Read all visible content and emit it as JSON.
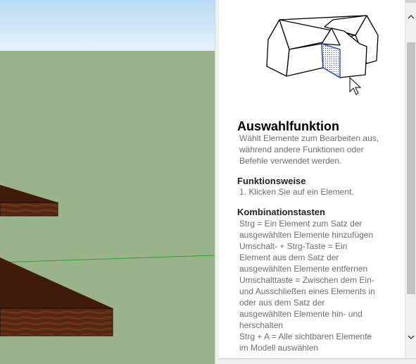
{
  "help_panel": {
    "title": "Auswahlfunktion",
    "description": "Wählt Elemente zum Bearbeiten aus, während andere Funktionen oder Befehle verwendet werden.",
    "sections": [
      {
        "heading": "Funktionsweise",
        "lines": [
          "1.  Klicken Sie auf ein Element."
        ]
      },
      {
        "heading": "Kombinationstasten",
        "lines": [
          "Strg = Ein Element zum Satz der",
          "ausgewählten Elemente hinzufügen",
          "Umschalt- + Strg-Taste = Ein",
          "Element aus dem Satz der",
          "ausgewählten Elemente entfernen",
          "Umschalttaste = Zwischen dem Ein-",
          "und Ausschließen eines Elements in",
          "oder aus dem Satz der",
          "ausgewählten Elemente hin- und",
          "herschalten",
          "Strg + A = Alle sichtbaren Elemente",
          "im Modell auswählen"
        ]
      }
    ],
    "illustration_icon": "house-select-illustration",
    "cursor_icon": "arrow-cursor-icon"
  },
  "scrollbar": {
    "up_icon": "chevron-up-icon",
    "down_icon": "chevron-down-icon"
  },
  "viewport": {
    "sky_color": "#cfe6f5",
    "ground_color": "#9ab38a",
    "wood_color": "#5a2a12",
    "axis_color": "#3aa63a"
  }
}
